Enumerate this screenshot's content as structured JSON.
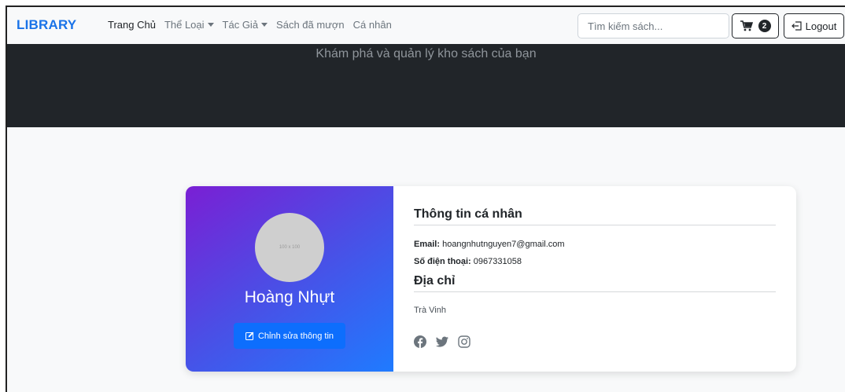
{
  "navbar": {
    "brand": "LIBRARY",
    "links": [
      {
        "label": "Trang Chủ",
        "active": true,
        "dropdown": false
      },
      {
        "label": "Thể Loại",
        "active": false,
        "dropdown": true
      },
      {
        "label": "Tác Giả",
        "active": false,
        "dropdown": true
      },
      {
        "label": "Sách đã mượn",
        "active": false,
        "dropdown": false
      },
      {
        "label": "Cá nhân",
        "active": false,
        "dropdown": false
      }
    ],
    "search": {
      "placeholder": "Tìm kiếm sách...",
      "value": ""
    },
    "cart": {
      "icon": "cart-icon",
      "count": "2"
    },
    "logout": {
      "icon": "logout-icon",
      "label": "Logout"
    }
  },
  "hero": {
    "tagline": "Khám phá và quản lý kho sách của bạn"
  },
  "profile": {
    "avatar_placeholder": "100 x 100",
    "name": "Hoàng Nhựt",
    "edit_button": "Chỉnh sửa thông tin",
    "info_title": "Thông tin cá nhân",
    "email_label": "Email:",
    "email": "hoangnhutnguyen7@gmail.com",
    "phone_label": "Số điện thoại:",
    "phone": "0967331058",
    "address_title": "Địa chỉ",
    "address": "Trà Vinh",
    "socials": [
      "facebook-icon",
      "twitter-icon",
      "instagram-icon"
    ]
  },
  "colors": {
    "brand": "#1a73e8",
    "hero_bg": "#212529",
    "primary_button": "#0d6efd",
    "gradient_start": "#7a1fd4",
    "gradient_end": "#1f7bff"
  }
}
